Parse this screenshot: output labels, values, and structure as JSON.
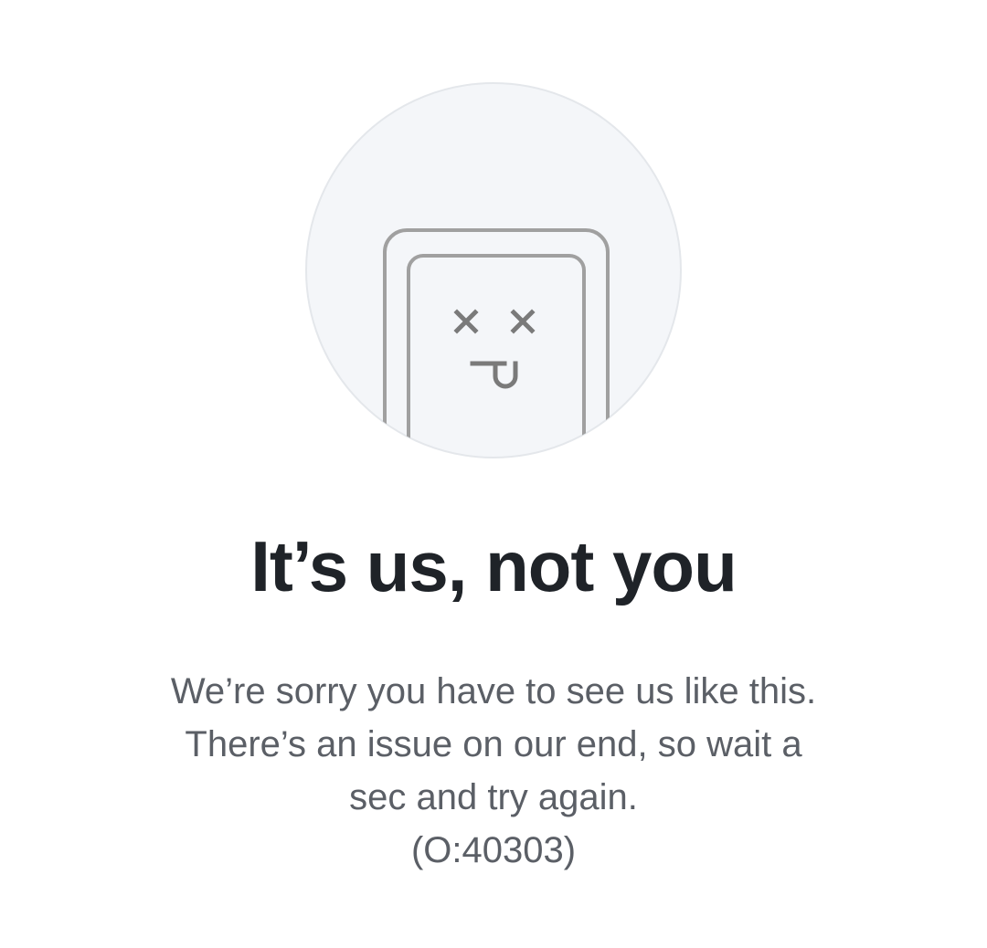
{
  "error_page": {
    "illustration_icon": "broken-phone-face-icon",
    "title": "It’s us, not you",
    "message_lines": [
      "We’re sorry you have to see us like this.",
      "There’s an issue on our end, so wait a",
      "sec and try again."
    ],
    "error_code": "(O:40303)"
  },
  "colors": {
    "circle_fill": "#f4f6f9",
    "circle_stroke": "#e4e7eb",
    "phone_stroke": "#9a9a9a",
    "face_stroke": "#7a7a7a",
    "title_text": "#1f2328",
    "body_text": "#5b5f66"
  }
}
